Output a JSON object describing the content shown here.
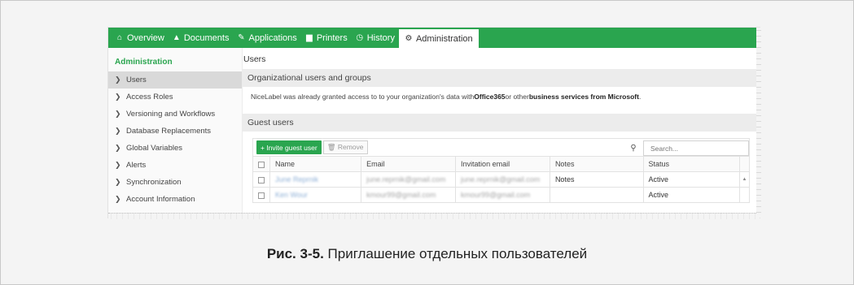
{
  "nav": {
    "items": [
      {
        "icon": "home-icon",
        "glyph": "⌂",
        "label": "Overview"
      },
      {
        "icon": "lock-icon",
        "glyph": "▲",
        "label": "Documents"
      },
      {
        "icon": "edit-icon",
        "glyph": "✎",
        "label": "Applications"
      },
      {
        "icon": "printer-icon",
        "glyph": "▆",
        "label": "Printers"
      },
      {
        "icon": "clock-icon",
        "glyph": "◷",
        "label": "History"
      },
      {
        "icon": "gears-icon",
        "glyph": "⚙",
        "label": "Administration"
      }
    ],
    "active": "Administration"
  },
  "sidebar": {
    "title": "Administration",
    "items": [
      {
        "label": "Users",
        "active": true
      },
      {
        "label": "Access Roles"
      },
      {
        "label": "Versioning and Workflows"
      },
      {
        "label": "Database Replacements"
      },
      {
        "label": "Global Variables"
      },
      {
        "label": "Alerts"
      },
      {
        "label": "Synchronization"
      },
      {
        "label": "Account Information"
      }
    ]
  },
  "main": {
    "title": "Users",
    "org_section": {
      "heading": "Organizational users and groups",
      "text_1": "NiceLabel was already granted access to to your organization's data with ",
      "bold_1": "Office365",
      "text_2": " or other ",
      "bold_2": "business services from Microsoft",
      "text_3": "."
    },
    "guest_section": {
      "heading": "Guest users",
      "invite_label": "+ Invite guest user",
      "remove_label": "🗑 Remove",
      "search_placeholder": "Search...",
      "columns": [
        "Name",
        "Email",
        "Invitation email",
        "Notes",
        "Status"
      ],
      "rows": [
        {
          "name": "June Reprnik",
          "email": "june.reprnik@gmail.com",
          "invitation_email": "june.reprnik@gmail.com",
          "notes": "Notes",
          "status": "Active"
        },
        {
          "name": "Ken Wour",
          "email": "kmour99@gmail.com",
          "invitation_email": "kmour99@gmail.com",
          "notes": "",
          "status": "Active"
        }
      ]
    }
  },
  "caption": {
    "label": "Рис. 3-5.",
    "text": " Приглашение отдельных пользователей"
  },
  "colors": {
    "accent": "#2aa54f",
    "sidebar_active": "#d9d9d9",
    "section_bg": "#ececec"
  }
}
